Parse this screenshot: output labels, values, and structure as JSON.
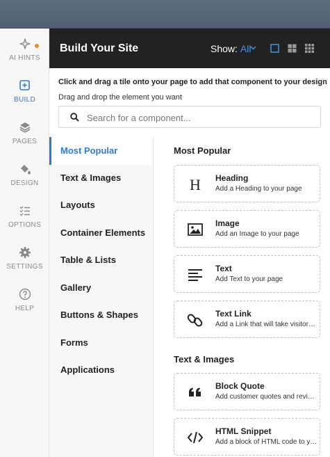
{
  "rail": {
    "items": [
      {
        "label": "AI HINTS",
        "icon": "sparkle-icon",
        "active": false
      },
      {
        "label": "BUILD",
        "icon": "add-square-icon",
        "active": true
      },
      {
        "label": "PAGES",
        "icon": "layers-icon",
        "active": false
      },
      {
        "label": "DESIGN",
        "icon": "paint-bucket-icon",
        "active": false
      },
      {
        "label": "OPTIONS",
        "icon": "checklist-icon",
        "active": false
      },
      {
        "label": "SETTINGS",
        "icon": "gear-icon",
        "active": false
      },
      {
        "label": "HELP",
        "icon": "help-circle-icon",
        "active": false
      }
    ]
  },
  "header": {
    "title": "Build Your Site",
    "show_label": "Show:",
    "show_value": "All"
  },
  "intro": {
    "line1": "Click and drag a tile onto your page to add that component to your design",
    "line2": "Drag and drop the element you want"
  },
  "search": {
    "placeholder": "Search for a component..."
  },
  "categories": [
    {
      "label": "Most Popular",
      "active": true
    },
    {
      "label": "Text & Images",
      "active": false
    },
    {
      "label": "Layouts",
      "active": false
    },
    {
      "label": "Container Elements",
      "active": false
    },
    {
      "label": "Table & Lists",
      "active": false
    },
    {
      "label": "Gallery",
      "active": false
    },
    {
      "label": "Buttons & Shapes",
      "active": false
    },
    {
      "label": "Forms",
      "active": false
    },
    {
      "label": "Applications",
      "active": false
    }
  ],
  "sections": [
    {
      "title": "Most Popular"
    },
    {
      "title": "Text & Images"
    }
  ],
  "tiles": [
    {
      "name": "Heading",
      "desc": "Add a Heading to your page",
      "icon": "heading-icon"
    },
    {
      "name": "Image",
      "desc": "Add an Image to your page",
      "icon": "image-icon"
    },
    {
      "name": "Text",
      "desc": "Add Text to your page",
      "icon": "text-align-icon"
    },
    {
      "name": "Text Link",
      "desc": "Add a Link that will take visitors to another page",
      "icon": "link-icon"
    },
    {
      "name": "Block Quote",
      "desc": "Add customer quotes and reviews to your page",
      "icon": "quote-icon"
    },
    {
      "name": "HTML Snippet",
      "desc": "Add a block of HTML code to your page",
      "icon": "code-icon"
    }
  ],
  "colors": {
    "accent": "#2b7bd9",
    "header_bg": "#222222",
    "badge": "#f08a24"
  }
}
